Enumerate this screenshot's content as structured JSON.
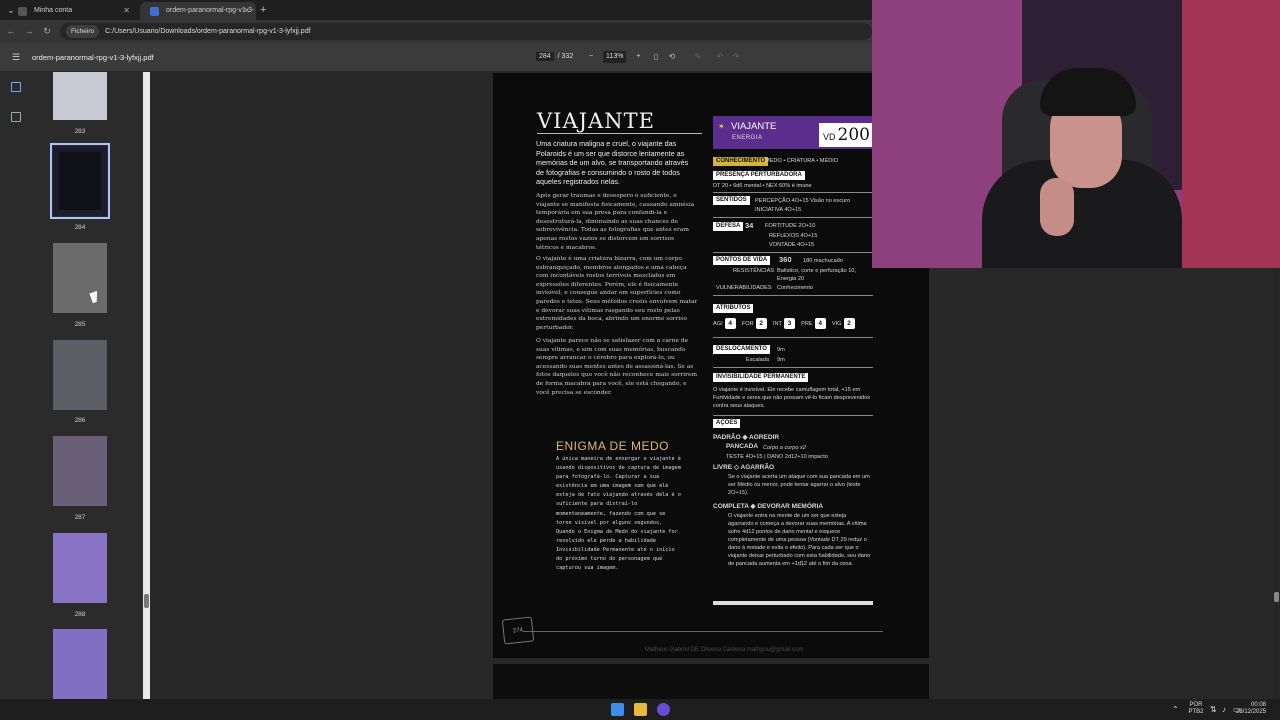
{
  "browser": {
    "tabs": [
      {
        "title": "Minha conta",
        "active": false
      },
      {
        "title": "ordem-paranormal-rpg-v1-3-ly",
        "active": true
      }
    ],
    "address_chip": "Ficheiro",
    "url": "C:/Users/Usuario/Downloads/ordem-paranormal-rpg-v1-3-lyfxjj.pdf"
  },
  "pdf_toolbar": {
    "filename": "ordem-paranormal-rpg-v1-3-lyfxjj.pdf",
    "current_page": "284",
    "total_pages": "/ 332",
    "zoom": "113%",
    "zoom_out": "−",
    "zoom_in": "+"
  },
  "thumbnails": [
    {
      "label": "283",
      "selected": false
    },
    {
      "label": "284",
      "selected": true
    },
    {
      "label": "285",
      "selected": false
    },
    {
      "label": "286",
      "selected": false
    },
    {
      "label": "287",
      "selected": false
    },
    {
      "label": "288",
      "selected": false
    }
  ],
  "page": {
    "title": "VIAJANTE",
    "lead": "Uma criatura maligna e cruel, o viajante das Polaroids é um ser que distorce lentamente as memórias de um alvo, se transportando através de fotografias e consumindo o rosto de todos aqueles registrados nelas.",
    "body1": "Após gerar traumas e desespero o suficiente, o viajante se manifesta fisicamente, causando amnésia temporária em sua presa para confundi-la e desestruturá-la, diminuindo as suas chances de sobrevivência. Todas as fotografias que antes eram apenas rostos vazios se distorcem em sorrisos tétricos e macabros.",
    "body2": "O viajante é uma criatura bizarra, com um corpo esbranquiçado, membros alongados e uma cabeça com incontáveis rostos terríveis mesclados em expressões diferentes. Porém, ele é fisicamente invisível, e consegue andar em superfícies como paredes e tetos. Seus métodos cruéis envolvem matar e devorar suas vítimas rasgando seu rosto pelas extremidades da boca, abrindo um enorme sorriso perturbador.",
    "body3": "O viajante parece não se satisfazer com a carne de suas vítimas, e sim com suas memórias, buscando sempre arrancar o cérebro para explorá-lo, ou acessando suas mentes antes de assassiná-las. Se as fotos daqueles que você não reconhece mais sorrirem de forma macabra para você, ele está chegando, e você precisa se esconder.",
    "enigma_title": "ENIGMA DE MEDO",
    "enigma_text": "A única maneira de enxergar o viajante é usando dispositivos de captura de imagem para fotografá-lo. Capturar a sua existência em uma imagem sem que ele esteja de fato viajando através dela é o suficiente para distraí-lo momentaneamente, fazendo com que se torne visível por alguns segundos. Quando o Enigma de Medo do viajante for resolvido ele perde a habilidade Invisibilidade Permanente até o início do próximo turno do personagem que capturou sua imagem.",
    "page_number": "274",
    "watermark": "Matheus Gabriel DE Oliveira Caldeira mathgnu@gmail.com"
  },
  "statblock": {
    "name": "VIAJANTE",
    "element": "ENERGIA",
    "vd_label": "VD",
    "vd_value": "200",
    "conhecimento_label": "CONHECIMENTO",
    "tags": "MEDO • CRIATURA • MÉDIO",
    "presenca_h": "PRESENÇA PERTURBADORA",
    "presenca": "DT 20 • 6d6 mental • NEX 60% é imune",
    "sentidos_h": "SENTIDOS",
    "percepcao": "PERCEPÇÃO  4O+15   Visão no escuro",
    "iniciativa": "INICIATIVA  4O+15",
    "defesa_h": "DEFESA",
    "defesa": "34",
    "fortitude": "FORTITUDE  2O+10",
    "reflexos": "REFLEXOS  4O+15",
    "vontade": "VONTADE  4O+15",
    "pv_h": "PONTOS DE VIDA",
    "pv": "360",
    "pv_extra": "180 machucado",
    "resist_label": "RESISTÊNCIAS",
    "resist": "Balístico, corte e perfuração 10, Energia 20",
    "vuln_label": "VULNERABILIDADES",
    "vuln": "Conhecimento",
    "atributos_h": "ATRIBUTOS",
    "attrs": [
      {
        "n": "AGI",
        "v": "4"
      },
      {
        "n": "FOR",
        "v": "2"
      },
      {
        "n": "INT",
        "v": "3"
      },
      {
        "n": "PRE",
        "v": "4"
      },
      {
        "n": "VIG",
        "v": "2"
      }
    ],
    "desloc_h": "DESLOCAMENTO",
    "desloc1": "9m",
    "escalada_label": "Escalada",
    "desloc2": "9m",
    "invis_h": "INVISIBILIDADE PERMANENTE",
    "invis": "O viajante é invisível. Ele recebe camuflagem total, +15 em Furtividade e seres que não possam vê-lo ficam desprevenidos contra seus ataques.",
    "acoes_h": "AÇÕES",
    "padrao": "PADRÃO ◆ AGREDIR",
    "pancada": "PANCADA",
    "pancada_desc": "Corpo a corpo x2",
    "teste": "TESTE 4O+15 | DANO 2d12+10 impacto",
    "livre": "LIVRE ◇ AGARRÃO",
    "livre_desc": "Se o viajante acerta um ataque com sua pancada em um ser Médio ou menor, pode tentar agarrar o alvo (teste 2O+15).",
    "completa": "COMPLETA ◆ DEVORAR MEMÓRIA",
    "completa_desc": "O viajante entra na mente de um ser que esteja agarrando e começa a devorar suas memórias. A vítima sofre 4d12 pontos de dano mental e esquece completamente de uma pessoa (Vontade DT 29 reduz o dano à metade e evita o efeito). Para cada ser que o viajante deixar perturbado com esta habilidade, seu dano de pancada aumenta em +1d12 até o fim da cena."
  },
  "taskbar": {
    "lang1": "POR",
    "lang2": "PTB2",
    "time": "00:08",
    "date": "28/12/2025"
  }
}
